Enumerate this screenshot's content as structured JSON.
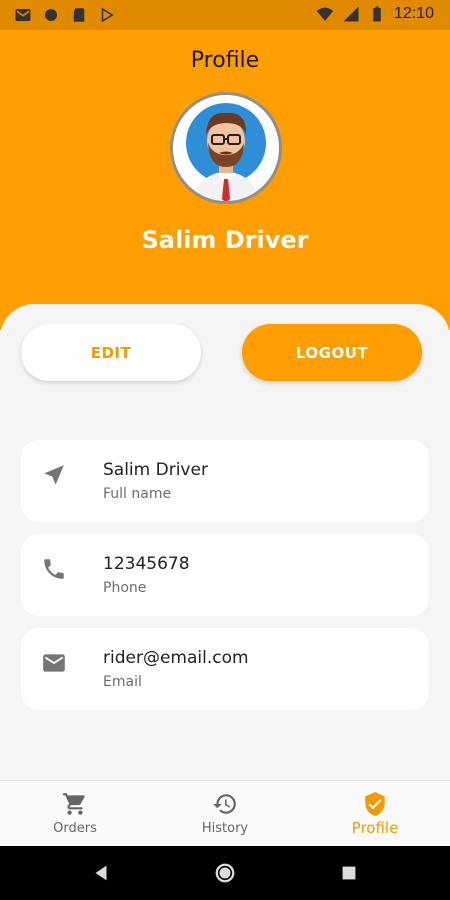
{
  "status_bar": {
    "time": "12:10",
    "left_icons": [
      "gmail-icon",
      "circle-icon",
      "sd-card-icon",
      "play-store-icon"
    ],
    "right_icons": [
      "wifi-icon",
      "signal-icon",
      "battery-icon"
    ]
  },
  "header": {
    "title": "Profile",
    "avatar": "avatar",
    "user_name": "Salim Driver",
    "background_color": "#ff9e00"
  },
  "actions": {
    "edit_label": "EDIT",
    "logout_label": "LOGOUT"
  },
  "info_cards": [
    {
      "icon": "navigation-arrow-icon",
      "value": "Salim Driver",
      "label": "Full name"
    },
    {
      "icon": "phone-icon",
      "value": "12345678",
      "label": "Phone"
    },
    {
      "icon": "email-icon",
      "value": "rider@email.com",
      "label": "Email"
    }
  ],
  "bottom_nav": {
    "items": [
      {
        "icon": "cart-icon",
        "label": "Orders",
        "active": false
      },
      {
        "icon": "history-icon",
        "label": "History",
        "active": false
      },
      {
        "icon": "shield-check-icon",
        "label": "Profile",
        "active": true
      }
    ]
  },
  "colors": {
    "accent": "#ff9e00",
    "accent_text": "#f39a00",
    "status_bar": "#e08a00"
  }
}
